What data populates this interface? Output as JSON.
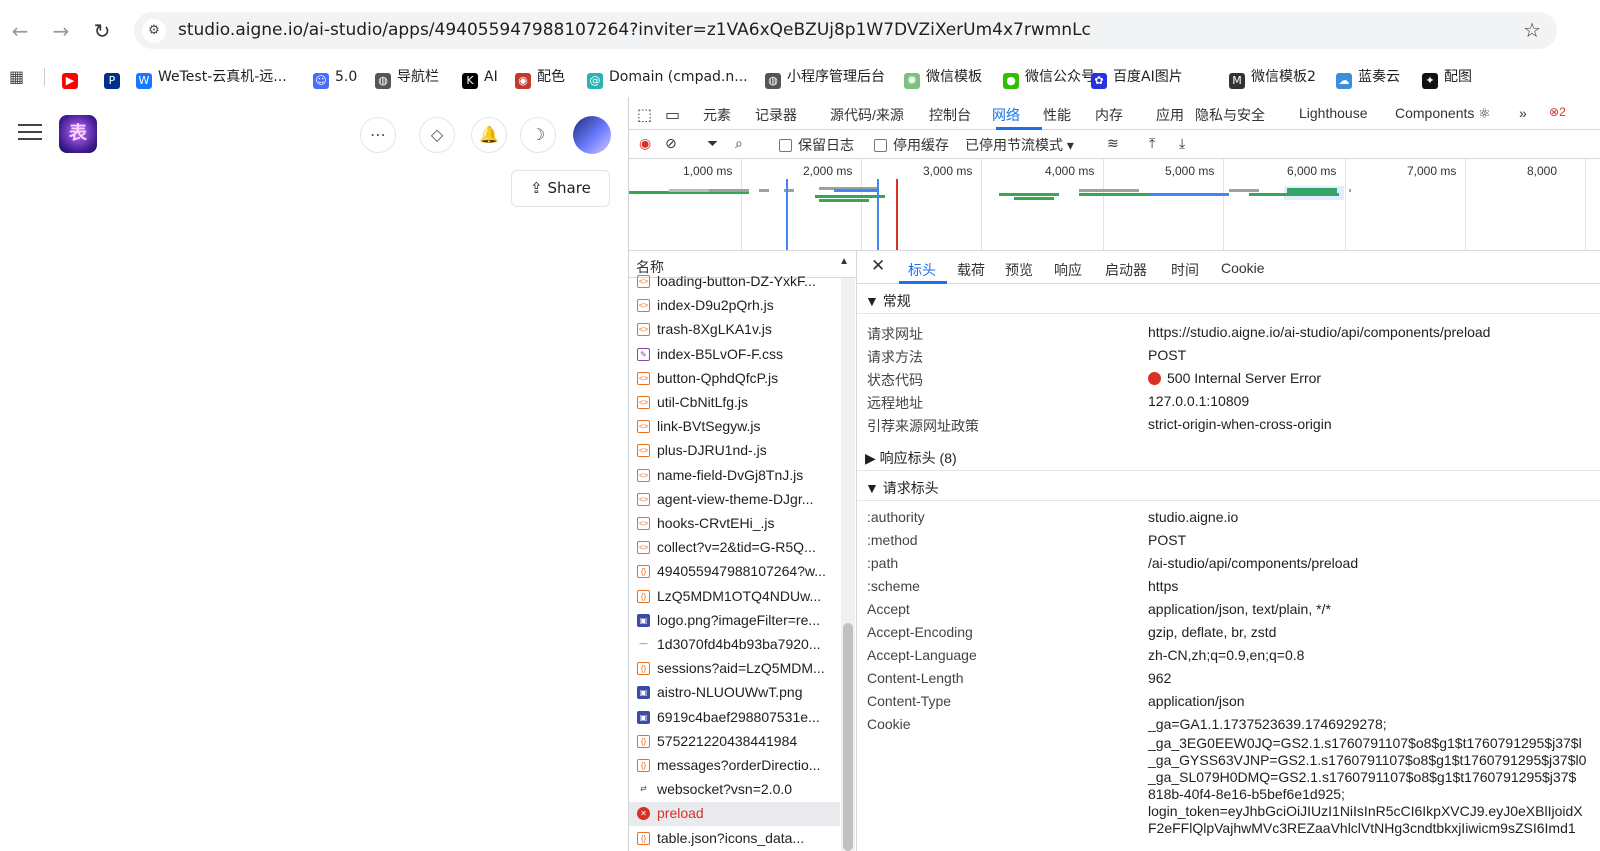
{
  "browser": {
    "url": "studio.aigne.io/ai-studio/apps/494055947988107264?inviter=z1VA6xQeBZUj8p1W7DVZiXerUm4x7rwmnLc",
    "bookmarks": [
      {
        "label": "",
        "icon": "youtube-icon",
        "color": "#ff0000"
      },
      {
        "label": "",
        "icon": "paypal-icon",
        "color": "#003087"
      },
      {
        "label": "WeTest-云真机-远...",
        "icon": "wetest-icon",
        "color": "#1677ff"
      },
      {
        "label": "5.0",
        "icon": "bot-icon",
        "color": "#4b6bfb"
      },
      {
        "label": "导航栏",
        "icon": "globe-icon",
        "color": "#555555"
      },
      {
        "label": "AI",
        "icon": "k-icon",
        "color": "#000000"
      },
      {
        "label": "配色",
        "icon": "palette-icon",
        "color": "#c0392b"
      },
      {
        "label": "Domain (cmpad.n...",
        "icon": "swirl-icon",
        "color": "#2bb3b1"
      },
      {
        "label": "小程序管理后台",
        "icon": "globe-icon",
        "color": "#555555"
      },
      {
        "label": "微信模板",
        "icon": "sun-icon",
        "color": "#7ec07e"
      },
      {
        "label": "微信公众号",
        "icon": "wechat-icon",
        "color": "#2dc100"
      },
      {
        "label": "百度AI图片",
        "icon": "paw-icon",
        "color": "#2932e1"
      },
      {
        "label": "微信模板2",
        "icon": "m-icon",
        "color": "#333333"
      },
      {
        "label": "蓝奏云",
        "icon": "cloud-icon",
        "color": "#3c8dde"
      },
      {
        "label": "配图",
        "icon": "openai-icon",
        "color": "#111111"
      }
    ]
  },
  "app": {
    "logo_text": "表",
    "share_label": "Share"
  },
  "devtools": {
    "tabs": [
      "元素",
      "记录器",
      "源代码/来源",
      "控制台",
      "网络",
      "性能",
      "内存",
      "应用",
      "隐私与安全",
      "Lighthouse",
      "Components ⚛"
    ],
    "active_tab": "网络",
    "error_count": "2",
    "toolbar": {
      "preserve_log": "保留日志",
      "disable_cache": "停用缓存",
      "throttle": "已停用节流模式"
    },
    "timeline_ticks": [
      "1,000 ms",
      "2,000 ms",
      "3,000 ms",
      "4,000 ms",
      "5,000 ms",
      "6,000 ms",
      "7,000 ms",
      "8,000"
    ],
    "name_header": "名称",
    "requests": [
      {
        "name": "loading-button-DZ-YxkF...",
        "type": "js"
      },
      {
        "name": "index-D9u2pQrh.js",
        "type": "js"
      },
      {
        "name": "trash-8XgLKA1v.js",
        "type": "js"
      },
      {
        "name": "index-B5LvOF-F.css",
        "type": "css"
      },
      {
        "name": "button-QphdQfcP.js",
        "type": "js"
      },
      {
        "name": "util-CbNitLfg.js",
        "type": "js"
      },
      {
        "name": "link-BVtSegyw.js",
        "type": "js"
      },
      {
        "name": "plus-DJRU1nd-.js",
        "type": "js"
      },
      {
        "name": "name-field-DvGj8TnJ.js",
        "type": "js"
      },
      {
        "name": "agent-view-theme-DJgr...",
        "type": "js"
      },
      {
        "name": "hooks-CRvtEHi_.js",
        "type": "js"
      },
      {
        "name": "collect?v=2&tid=G-R5Q...",
        "type": "js"
      },
      {
        "name": "494055947988107264?w...",
        "type": "fetch"
      },
      {
        "name": "LzQ5MDM1OTQ4NDUw...",
        "type": "fetch"
      },
      {
        "name": "logo.png?imageFilter=re...",
        "type": "img"
      },
      {
        "name": "1d3070fd4b4b93ba7920...",
        "type": "other"
      },
      {
        "name": "sessions?aid=LzQ5MDM...",
        "type": "fetch"
      },
      {
        "name": "aistro-NLUOUWwT.png",
        "type": "img"
      },
      {
        "name": "6919c4baef298807531e...",
        "type": "img"
      },
      {
        "name": "575221220438441984",
        "type": "fetch"
      },
      {
        "name": "messages?orderDirectio...",
        "type": "fetch"
      },
      {
        "name": "websocket?vsn=2.0.0",
        "type": "ws"
      },
      {
        "name": "preload",
        "type": "error"
      },
      {
        "name": "table.json?icons_data...",
        "type": "fetch"
      }
    ],
    "detail_tabs": [
      "标头",
      "载荷",
      "预览",
      "响应",
      "启动器",
      "时间",
      "Cookie"
    ],
    "general_title": "▼ 常规",
    "general": [
      {
        "k": "请求网址",
        "v": "https://studio.aigne.io/ai-studio/api/components/preload"
      },
      {
        "k": "请求方法",
        "v": "POST"
      },
      {
        "k": "状态代码",
        "v": "500 Internal Server Error"
      },
      {
        "k": "远程地址",
        "v": "127.0.0.1:10809"
      },
      {
        "k": "引荐来源网址政策",
        "v": "strict-origin-when-cross-origin"
      }
    ],
    "response_headers_title": "▶ 响应标头 (8)",
    "request_headers_title": "▼ 请求标头",
    "request_headers": [
      {
        "k": ":authority",
        "v": "studio.aigne.io"
      },
      {
        "k": ":method",
        "v": "POST"
      },
      {
        "k": ":path",
        "v": "/ai-studio/api/components/preload"
      },
      {
        "k": ":scheme",
        "v": "https"
      },
      {
        "k": "Accept",
        "v": "application/json, text/plain, */*"
      },
      {
        "k": "Accept-Encoding",
        "v": "gzip, deflate, br, zstd"
      },
      {
        "k": "Accept-Language",
        "v": "zh-CN,zh;q=0.9,en;q=0.8"
      },
      {
        "k": "Content-Length",
        "v": "962"
      },
      {
        "k": "Content-Type",
        "v": "application/json"
      },
      {
        "k": "Cookie",
        "v": "_ga=GA1.1.1737523639.1746929278;"
      }
    ],
    "cookie_lines": [
      "_ga_3EG0EEW0JQ=GS2.1.s1760791107$o8$g1$t1760791295$j37$l",
      "_ga_GYSS63VJNP=GS2.1.s1760791107$o8$g1$t1760791295$j37$l0",
      "_ga_SL079H0DMQ=GS2.1.s1760791107$o8$g1$t1760791295$j37$",
      "818b-40f4-8e16-b5bef6e1d925;",
      "login_token=eyJhbGciOiJIUzI1NiIsInR5cCI6IkpXVCJ9.eyJ0eXBlIjoidX",
      "F2eFFlQlpVajhwMVc3REZaaVhlclVtNHg3cndtbkxjIiwicm9sZSI6Imd1"
    ]
  }
}
